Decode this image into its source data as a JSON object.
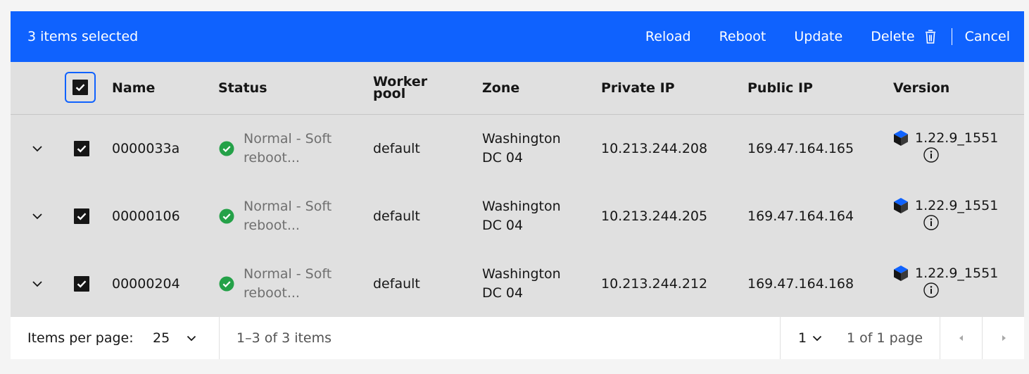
{
  "batch": {
    "selected_label": "3 items selected",
    "actions": {
      "reload": "Reload",
      "reboot": "Reboot",
      "update": "Update",
      "delete": "Delete",
      "cancel": "Cancel"
    },
    "background": "#0f62fe"
  },
  "table": {
    "headers": {
      "name": "Name",
      "status": "Status",
      "worker_pool_1": "Worker",
      "worker_pool_2": "pool",
      "zone": "Zone",
      "private_ip": "Private IP",
      "public_ip": "Public IP",
      "version": "Version"
    },
    "rows": [
      {
        "name": "0000033a",
        "status_1": "Normal - Soft",
        "status_2": "reboot...",
        "worker_pool": "default",
        "zone_1": "Washington",
        "zone_2": "DC 04",
        "private_ip": "10.213.244.208",
        "public_ip": "169.47.164.165",
        "version": "1.22.9_1551"
      },
      {
        "name": "00000106",
        "status_1": "Normal - Soft",
        "status_2": "reboot...",
        "worker_pool": "default",
        "zone_1": "Washington",
        "zone_2": "DC 04",
        "private_ip": "10.213.244.205",
        "public_ip": "169.47.164.164",
        "version": "1.22.9_1551"
      },
      {
        "name": "00000204",
        "status_1": "Normal - Soft",
        "status_2": "reboot...",
        "worker_pool": "default",
        "zone_1": "Washington",
        "zone_2": "DC 04",
        "private_ip": "10.213.244.212",
        "public_ip": "169.47.164.168",
        "version": "1.22.9_1551"
      }
    ],
    "status_color": "#24a148"
  },
  "pagination": {
    "items_per_page_label": "Items per page:",
    "items_per_page_value": "25",
    "range_text": "1–3 of 3 items",
    "page_value": "1",
    "page_total_text": "1 of 1 page"
  }
}
